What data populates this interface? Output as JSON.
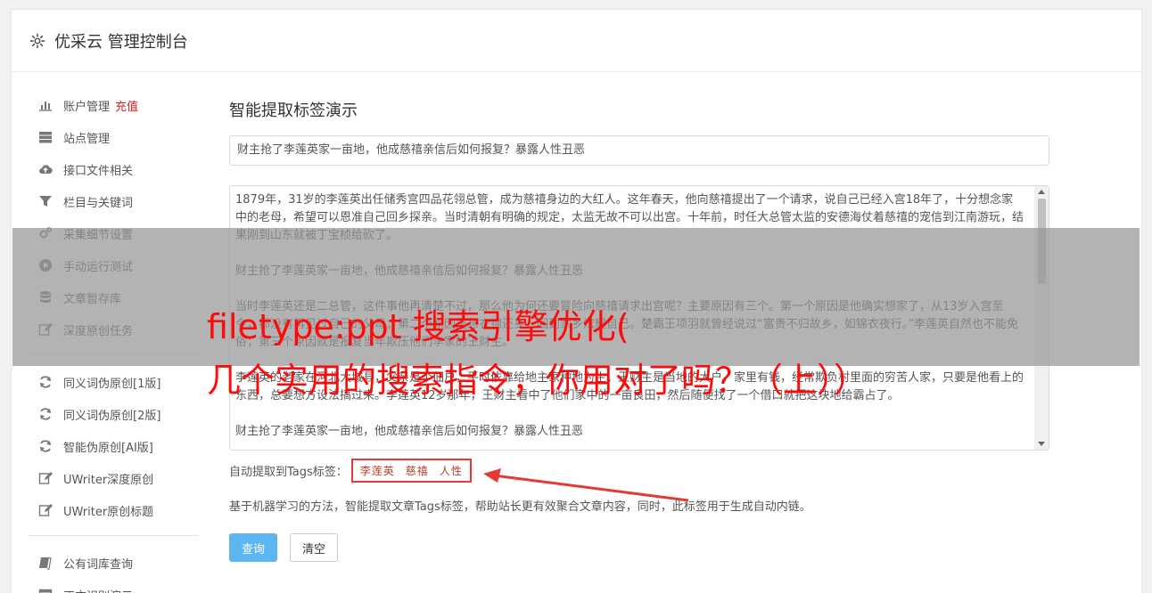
{
  "header": {
    "title": "优采云 管理控制台",
    "icon": "gear-icon"
  },
  "sidebar": {
    "group1": [
      {
        "label": "账户管理",
        "badge": "充值",
        "icon": "bar-chart-icon"
      },
      {
        "label": "站点管理",
        "icon": "server-icon"
      },
      {
        "label": "接口文件相关",
        "icon": "cloud-upload-icon"
      },
      {
        "label": "栏目与关键词",
        "icon": "filter-icon"
      },
      {
        "label": "采集细节设置",
        "icon": "cogs-icon"
      },
      {
        "label": "手动运行测试",
        "icon": "play-circle-icon"
      },
      {
        "label": "文章暂存库",
        "icon": "database-icon"
      },
      {
        "label": "深度原创任务",
        "icon": "edit-icon"
      }
    ],
    "group2": [
      {
        "label": "同义词伪原创[1版]",
        "icon": "refresh-icon"
      },
      {
        "label": "同义词伪原创[2版]",
        "icon": "refresh-icon"
      },
      {
        "label": "智能伪原创[AI版]",
        "icon": "refresh-icon"
      },
      {
        "label": "UWriter深度原创",
        "icon": "edit-icon"
      },
      {
        "label": "UWriter原创标题",
        "icon": "edit-icon"
      }
    ],
    "group3": [
      {
        "label": "公有词库查询",
        "icon": "book-icon"
      },
      {
        "label": "正文识别演示",
        "icon": "window-icon"
      }
    ]
  },
  "main": {
    "title": "智能提取标签演示",
    "title_input_value": "财主抢了李莲英家一亩地，他成慈禧亲信后如何报复？暴露人性丑恶",
    "content_paragraphs": [
      "1879年，31岁的李莲英出任储秀宫四品花翎总管，成为慈禧身边的大红人。这年春天，他向慈禧提出了一个请求，说自己已经入宫18年了，十分想念家中的老母，希望可以恩准自己回乡探亲。当时清朝有明确的规定，太监无故不可以出宫。十年前，时任大总管太监的安德海仗着慈禧的宠信到江南游玩，结果刚到山东就被丁宝桢给砍了。",
      "财主抢了李莲英家一亩地，他成慈禧亲信后如何报复？暴露人性丑恶",
      "当时李莲英还是二总管，这件事他再清楚不过，那么他为何还要冒险向慈禧请求出宫呢？主要原因有三个。第一个原因是他确实想家了，从13岁入宫至今，都没有再见过自己的父母；第二个原因是想衣锦还乡，回到家乡炫耀自己。楚霸王项羽就曾经说过“富贵不归故乡，如锦衣夜行。”李莲英自然也不能免俗；第三个原因就是报复当年欺压他们李家的王财主。",
      "李莲英的老家在河北大城县，父亲是个佃户，平时依靠给地主家种地为生。王财主是当地的大户，家里有钱，经常欺负村里面的穷苦人家，只要是他看上的东西，总要想方设法搞过来。李莲英12岁那年，王财主看中了他们家中的一亩良田，然后随便找了一个借口就把这块地给霸占了。",
      "财主抢了李莲英家一亩地，他成慈禧亲信后如何报复？暴露人性丑恶"
    ],
    "tags_label": "自动提取到Tags标签：",
    "tags": [
      "李莲英",
      "慈禧",
      "人性"
    ],
    "description": "基于机器学习的方法，智能提取文章Tags标签，帮助站长更有效聚合文章内容，同时，此标签用于生成自动内链。",
    "query_button": "查询",
    "clear_button": "清空"
  },
  "overlay": {
    "line1": "filetype:ppt 搜索引擎优化(",
    "line2": "几个实用的搜索指令，你用对了吗？（上））"
  },
  "colors": {
    "accent": "#5db6f0",
    "tag_border": "#e53935",
    "overlay_text": "#ff0a0a",
    "recharge": "#e02020"
  }
}
